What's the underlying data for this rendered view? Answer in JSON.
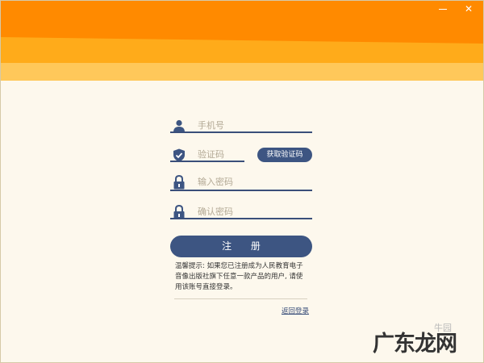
{
  "window": {
    "minimize_label": "",
    "close_label": "✕"
  },
  "colors": {
    "header_dark_orange": "#ff8a00",
    "header_mid_orange": "#ffab1a",
    "header_light_orange": "#ffc85a",
    "background": "#fdf8ed",
    "accent_navy": "#3d5582"
  },
  "form": {
    "phone": {
      "placeholder": "手机号",
      "icon": "user-icon"
    },
    "code": {
      "placeholder": "验证码",
      "icon": "shield-check-icon",
      "button_label": "获取验证码"
    },
    "password": {
      "placeholder": "输入密码",
      "icon": "lock-icon"
    },
    "confirm": {
      "placeholder": "确认密码",
      "icon": "lock-icon"
    },
    "register_label": "注 册",
    "notice": "温馨提示: 如果您已注册成为人民教育电子音像出版社旗下任意一款产品的用户, 请使用该账号直接登录。",
    "back_link": "返回登录"
  },
  "watermark": {
    "text": "广东龙网",
    "secondary": "牛园"
  }
}
